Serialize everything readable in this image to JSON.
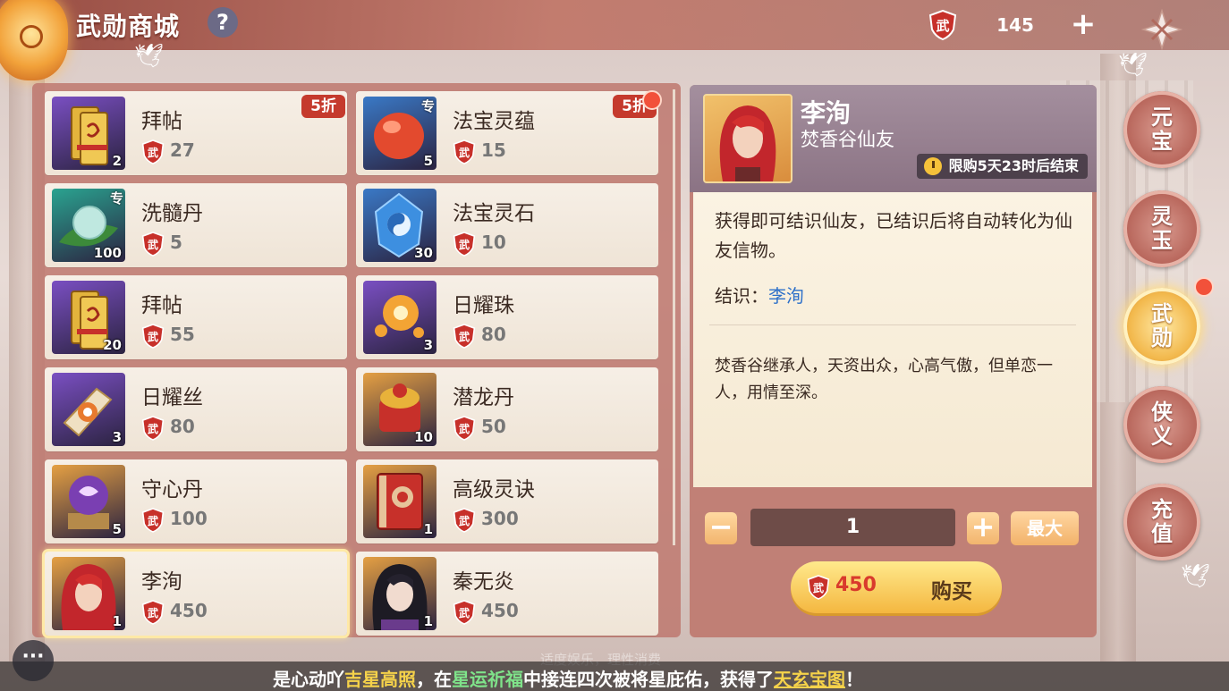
{
  "header": {
    "title": "武勋商城",
    "help_label": "?",
    "currency_icon": "wuxun-shield-icon",
    "currency_value": "145",
    "add_label": "+",
    "close_icon": "close-icon"
  },
  "items": [
    {
      "name": "拜帖",
      "price": "27",
      "count": "2",
      "discount": "5折",
      "tag": "",
      "icon": "scroll-letter-icon",
      "color": "#7a4fc2"
    },
    {
      "name": "法宝灵蕴",
      "price": "15",
      "count": "5",
      "discount": "5折",
      "tag": "专",
      "icon": "red-gem-icon",
      "color": "#3a79c6"
    },
    {
      "name": "洗髓丹",
      "price": "5",
      "count": "100",
      "discount": "",
      "tag": "专",
      "icon": "green-pearl-icon",
      "color": "#2aa390"
    },
    {
      "name": "法宝灵石",
      "price": "10",
      "count": "30",
      "discount": "",
      "tag": "",
      "icon": "blue-taiji-stone-icon",
      "color": "#3a79c6"
    },
    {
      "name": "拜帖",
      "price": "55",
      "count": "20",
      "discount": "",
      "tag": "",
      "icon": "scroll-letter-icon",
      "color": "#7a4fc2"
    },
    {
      "name": "日耀珠",
      "price": "80",
      "count": "3",
      "discount": "",
      "tag": "",
      "icon": "sun-orb-icon",
      "color": "#7a4fc2"
    },
    {
      "name": "日耀丝",
      "price": "80",
      "count": "3",
      "discount": "",
      "tag": "",
      "icon": "sun-silk-icon",
      "color": "#7a4fc2"
    },
    {
      "name": "潜龙丹",
      "price": "50",
      "count": "10",
      "discount": "",
      "tag": "",
      "icon": "dragon-pill-icon",
      "color": "#e5a043"
    },
    {
      "name": "守心丹",
      "price": "100",
      "count": "5",
      "discount": "",
      "tag": "",
      "icon": "purple-crystal-ball-icon",
      "color": "#e5a043"
    },
    {
      "name": "高级灵诀",
      "price": "300",
      "count": "1",
      "discount": "",
      "tag": "",
      "icon": "red-book-icon",
      "color": "#e5a043"
    },
    {
      "name": "李洵",
      "price": "450",
      "count": "1",
      "discount": "",
      "tag": "",
      "icon": "red-hair-portrait-icon",
      "color": "#e5a043",
      "selected": true
    },
    {
      "name": "秦无炎",
      "price": "450",
      "count": "1",
      "discount": "",
      "tag": "",
      "icon": "black-hair-portrait-icon",
      "color": "#e5a043"
    }
  ],
  "detail": {
    "name": "李洵",
    "subtitle": "焚香谷仙友",
    "limit_text": "限购5天23时后结束",
    "description": "获得即可结识仙友，已结识后将自动转化为仙友信物。",
    "bond_label": "结识：",
    "bond_name": "李洵",
    "bio": "焚香谷继承人，天资出众，心高气傲，但单恋一人，用情至深。",
    "quantity": "1",
    "minus_label": "−",
    "plus_label": "+",
    "max_label": "最大",
    "buy_price": "450",
    "buy_label": "购买"
  },
  "side_tabs": [
    {
      "label": "元宝",
      "active": false
    },
    {
      "label": "灵玉",
      "active": false
    },
    {
      "label": "武勋",
      "active": true
    },
    {
      "label": "侠义",
      "active": false
    },
    {
      "label": "充值",
      "active": false
    }
  ],
  "ticker": {
    "p1": "是心动吖",
    "p2": "吉星高照",
    "p3": "，在",
    "p4": "星运祈福",
    "p5": "中接连四次被将星庇佑，获得了",
    "p6": "天玄宝图",
    "p7": "！",
    "faded": "适度娱乐，理性消费"
  },
  "colors": {
    "accent_red": "#c53a2d",
    "gold": "#f4b740",
    "link_blue": "#2d70c9"
  }
}
